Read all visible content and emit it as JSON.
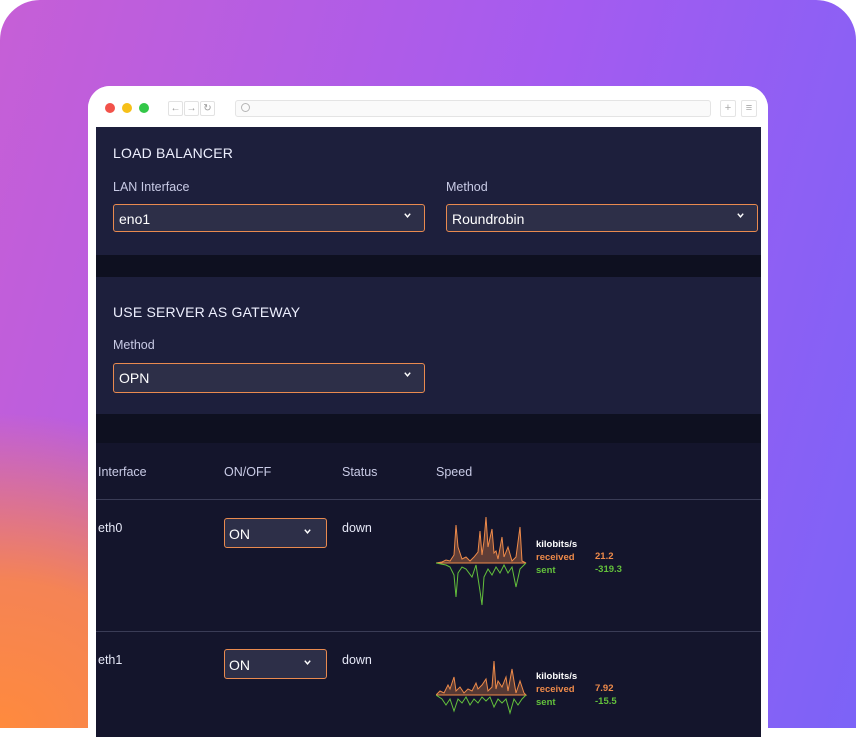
{
  "colors": {
    "accent_border": "#e98a4f",
    "received": "#ee8a4a",
    "sent": "#63c03c",
    "panel_bg": "#1d1f3c",
    "table_bg": "#14152c"
  },
  "browser": {
    "icons": [
      "back-icon",
      "forward-icon",
      "reload-icon",
      "search-icon",
      "new-tab-icon",
      "menu-icon"
    ]
  },
  "load_balancer": {
    "title": "LOAD BALANCER",
    "lan_label": "LAN Interface",
    "lan_value": "eno1",
    "method_label": "Method",
    "method_value": "Roundrobin"
  },
  "gateway": {
    "title": "USE SERVER AS GATEWAY",
    "method_label": "Method",
    "method_value": "OPN"
  },
  "interfaces": {
    "headers": {
      "interface": "Interface",
      "onoff": "ON/OFF",
      "status": "Status",
      "speed": "Speed"
    },
    "rows": [
      {
        "name": "eth0",
        "onoff": "ON",
        "status": "down",
        "unit": "kilobits/s",
        "received_label": "received",
        "received": "21.2",
        "sent_label": "sent",
        "sent": "-319.3"
      },
      {
        "name": "eth1",
        "onoff": "ON",
        "status": "down",
        "unit": "kilobits/s",
        "received_label": "received",
        "received": "7.92",
        "sent_label": "sent",
        "sent": "-15.5"
      }
    ]
  }
}
